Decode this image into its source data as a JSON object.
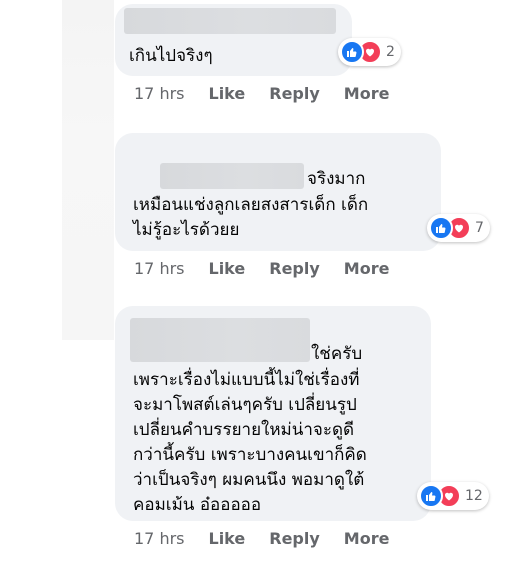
{
  "comments": [
    {
      "text": "เกินไปจริงๆ",
      "reaction_count": "2",
      "time": "17 hrs",
      "like": "Like",
      "reply": "Reply",
      "more": "More"
    },
    {
      "line1": "จริงมาก",
      "line2": "เหมือนแช่งลูกเลยสงสารเด็ก เด็ก",
      "line3": "ไม่รู้อะไรด้วยย",
      "reaction_count": "7",
      "time": "17 hrs",
      "like": "Like",
      "reply": "Reply",
      "more": "More"
    },
    {
      "line1": "ใช่ครับ",
      "line2": "เพราะเรื่องไม่แบบนี้ไม่ใช่เรื่องที่",
      "line3": "จะมาโพสต์เล่นๆครับ เปลี่ยนรูป",
      "line4": "เปลี่ยนคำบรรยายใหม่น่าจะดูดี",
      "line5": "กว่านี้ครับ เพราะบางคนเขาก็คิด",
      "line6": "ว่าเป็นจริงๆ ผมคนนึง พอมาดูใต้",
      "line7": "คอมเม้น อ๋อออออ",
      "reaction_count": "12",
      "time": "17 hrs",
      "like": "Like",
      "reply": "Reply",
      "more": "More"
    }
  ],
  "colors": {
    "bubble": "#f0f2f5",
    "like": "#1877f2",
    "love": "#f33e58",
    "meta": "#65676b"
  },
  "icons": {
    "like": "thumbs-up-icon",
    "love": "heart-icon"
  }
}
